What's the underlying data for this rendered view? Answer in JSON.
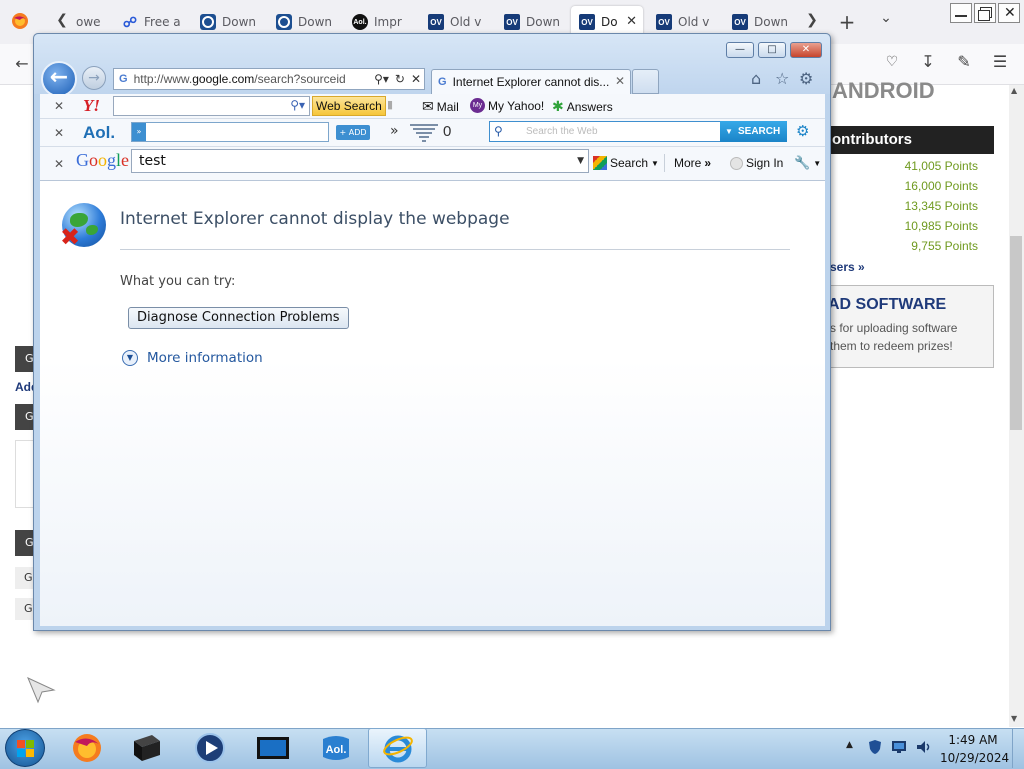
{
  "firefox": {
    "tabs": [
      {
        "title": "owe",
        "fav": "back-chevron"
      },
      {
        "title": "Free a",
        "fav": "free"
      },
      {
        "title": "Down",
        "fav": "ring"
      },
      {
        "title": "Down",
        "fav": "ring"
      },
      {
        "title": "Impr",
        "fav": "aol"
      },
      {
        "title": "Old v",
        "fav": "ov"
      },
      {
        "title": "Down",
        "fav": "ov"
      },
      {
        "title": "Do",
        "fav": "ov",
        "active": true
      },
      {
        "title": "Old v",
        "fav": "ov"
      },
      {
        "title": "Down",
        "fav": "ov"
      }
    ]
  },
  "bg_page": {
    "android_text": "ANDROID",
    "contributors_heading": "ontributors",
    "points": [
      "41,005 Points",
      "16,000 Points",
      "13,345 Points",
      "10,985 Points",
      "9,755 Points"
    ],
    "users_link": "sers »",
    "upload_title": "AD SOFTWARE",
    "upload_line1": "s for uploading software",
    "upload_line2": "them to redeem prizes!",
    "left_g": "G",
    "left_add": "Add"
  },
  "ie": {
    "address_url_prefix": "http://www.",
    "address_url_domain": "google.com",
    "address_url_suffix": "/search?sourceid",
    "tab_title": "Internet Explorer cannot dis...",
    "yahoo": {
      "logo": "Y!",
      "search_button": "Web Search",
      "links": [
        "Mail",
        "My Yahoo!",
        "Answers"
      ]
    },
    "aol": {
      "logo": "Aol.",
      "add_label": "+ ADD",
      "counter": "0",
      "search_placeholder": "Search the Web",
      "search_button": "SEARCH"
    },
    "google": {
      "logo": "Google",
      "query": "test",
      "search_label": "Search",
      "more_label": "More",
      "signin_label": "Sign In"
    },
    "error": {
      "title": "Internet Explorer cannot display the webpage",
      "try_label": "What you can try:",
      "diagnose_button": "Diagnose Connection Problems",
      "more_info": "More information"
    }
  },
  "taskbar": {
    "time": "1:49 AM",
    "date": "10/29/2024"
  }
}
